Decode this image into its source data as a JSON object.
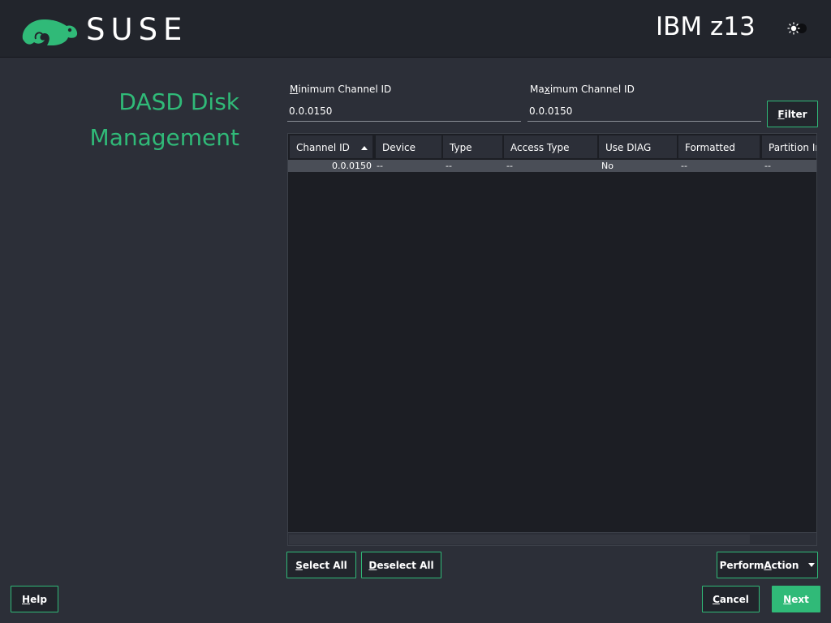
{
  "header": {
    "brand": "SUSE",
    "machine": "IBM z13",
    "theme_toggle_icon": "sun-icon",
    "brand_color": "#30ba78"
  },
  "page_title_line1": "DASD Disk",
  "page_title_line2": "Management",
  "filters": {
    "min_label_u": "M",
    "min_label_rest": "inimum Channel ID",
    "min_value": "0.0.0150",
    "max_label_pre": "Ma",
    "max_label_u": "x",
    "max_label_rest": "imum Channel ID",
    "max_value": "0.0.0150",
    "filter_u": "F",
    "filter_rest": "ilter"
  },
  "table": {
    "columns": [
      "Channel ID",
      "Device",
      "Type",
      "Access Type",
      "Use DIAG",
      "Formatted",
      "Partition In"
    ],
    "sort_column": "Channel ID",
    "sort_direction": "ascending",
    "rows": [
      [
        "0.0.0150",
        "--",
        "--",
        "--",
        "No",
        "--",
        "--"
      ]
    ]
  },
  "actions": {
    "select_all_u": "S",
    "select_all_rest": "elect All",
    "deselect_all_u": "D",
    "deselect_all_rest": "eselect All",
    "perform_pre": "Perform ",
    "perform_u": "A",
    "perform_rest": "ction",
    "help_u": "H",
    "help_rest": "elp",
    "cancel_u": "C",
    "cancel_rest": "ancel",
    "next_u": "N",
    "next_rest": "ext"
  }
}
